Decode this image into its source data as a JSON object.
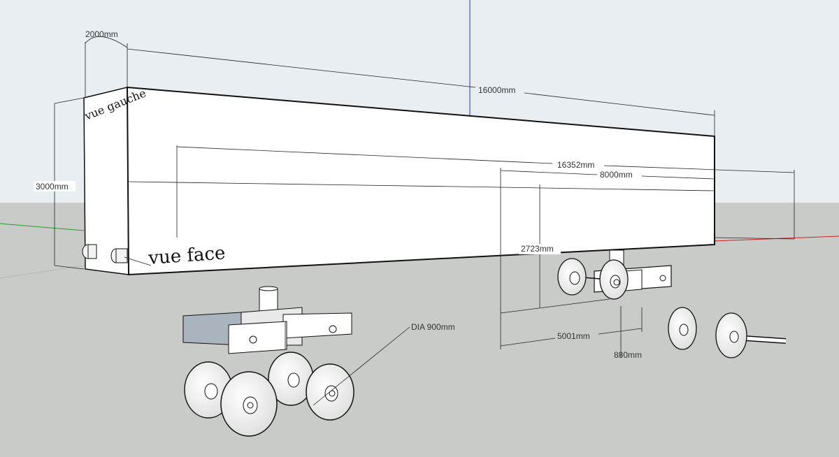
{
  "scene": {
    "colors": {
      "sky": "#e8eef2",
      "ground": "#c9cbc9",
      "face": "#ffffff",
      "edge": "#111111",
      "axis_red": "#d02020",
      "axis_green": "#20a020",
      "axis_blue": "#3030c0",
      "chassis_shade": "#a9b4bf"
    },
    "labels": {
      "vue_gauche": "vue gauche",
      "vue_face": "vue face"
    },
    "dimensions": {
      "d2000": "2000mm",
      "d16000": "16000mm",
      "d3000": "3000mm",
      "d16352": "16352mm",
      "d8000": "8000mm",
      "d2723": "2723mm",
      "d5001": "5001mm",
      "d880": "880mm",
      "dia": "DIA 900mm"
    }
  }
}
